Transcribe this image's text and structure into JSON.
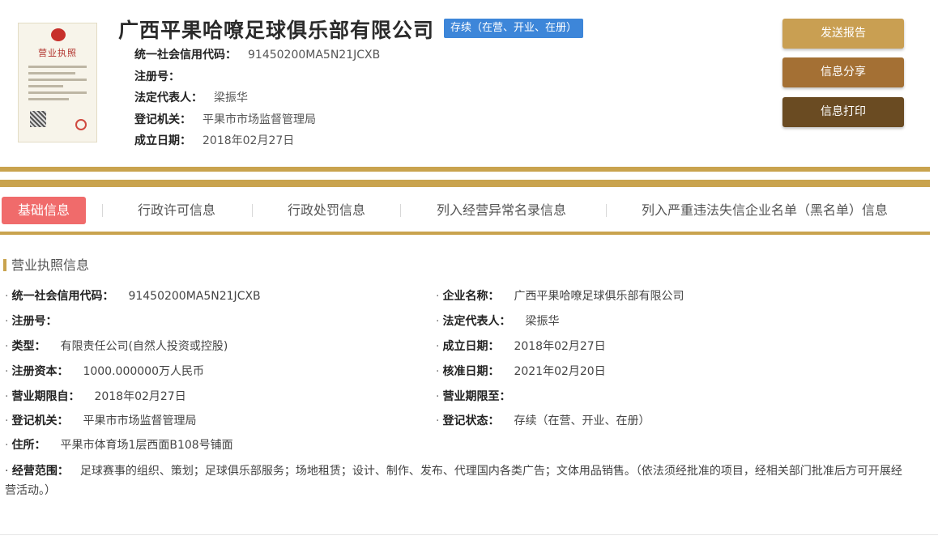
{
  "header": {
    "license_title": "营业执照",
    "company_name": "广西平果哈嘹足球俱乐部有限公司",
    "status": "存续（在营、开业、在册）",
    "credit_code_label": "统一社会信用代码：",
    "credit_code": "91450200MA5N21JCXB",
    "reg_no_label": "注册号：",
    "reg_no": "",
    "legal_rep_label": "法定代表人：",
    "legal_rep": "梁振华",
    "authority_label": "登记机关：",
    "authority": "平果市市场监督管理局",
    "founded_label": "成立日期：",
    "founded": "2018年02月27日"
  },
  "buttons": {
    "send_report": "发送报告",
    "share": "信息分享",
    "print": "信息打印"
  },
  "tabs": [
    {
      "label": "基础信息"
    },
    {
      "label": "行政许可信息"
    },
    {
      "label": "行政处罚信息"
    },
    {
      "label": "列入经营异常名录信息"
    },
    {
      "label": "列入严重违法失信企业名单（黑名单）信息"
    }
  ],
  "section": {
    "title": "营业执照信息",
    "bullet": "·",
    "fields": {
      "credit_code": {
        "k": "统一社会信用代码：",
        "v": "91450200MA5N21JCXB"
      },
      "company_name": {
        "k": "企业名称：",
        "v": "广西平果哈嘹足球俱乐部有限公司"
      },
      "reg_no": {
        "k": "注册号：",
        "v": ""
      },
      "legal_rep": {
        "k": "法定代表人：",
        "v": "梁振华"
      },
      "type": {
        "k": "类型：",
        "v": "有限责任公司(自然人投资或控股)"
      },
      "founded": {
        "k": "成立日期：",
        "v": "2018年02月27日"
      },
      "capital": {
        "k": "注册资本：",
        "v": "1000.000000万人民币"
      },
      "approved": {
        "k": "核准日期：",
        "v": "2021年02月20日"
      },
      "term_from": {
        "k": "营业期限自：",
        "v": "2018年02月27日"
      },
      "term_to": {
        "k": "营业期限至：",
        "v": ""
      },
      "authority": {
        "k": "登记机关：",
        "v": "平果市市场监督管理局"
      },
      "reg_status": {
        "k": "登记状态：",
        "v": "存续（在营、开业、在册）"
      },
      "address": {
        "k": "住所：",
        "v": "平果市体育场1层西面B108号铺面"
      },
      "scope": {
        "k": "经营范围：",
        "v": "足球赛事的组织、策划；足球俱乐部服务；场地租赁；设计、制作、发布、代理国内各类广告；文体用品销售。（依法须经批准的项目，经相关部门批准后方可开展经营活动。）"
      }
    }
  }
}
